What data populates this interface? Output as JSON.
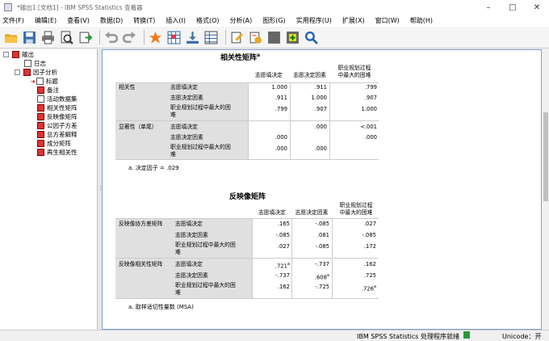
{
  "window": {
    "title": "*输出1 [文档1] - IBM SPSS Statistics 查看器"
  },
  "menu": [
    "文件(F)",
    "编辑(E)",
    "查看(V)",
    "数据(D)",
    "转换(T)",
    "插入(I)",
    "格式(O)",
    "分析(A)",
    "图形(G)",
    "实用程序(U)",
    "扩展(X)",
    "窗口(W)",
    "帮助(H)"
  ],
  "nav": {
    "items": [
      "输出",
      "日志",
      "因子分析",
      "标题",
      "备注",
      "活动数据集",
      "相关性矩阵",
      "反映像矩阵",
      "公因子方差",
      "总方差解释",
      "成分矩阵",
      "再生相关性"
    ]
  },
  "corr": {
    "title": "相关性矩阵",
    "sup": "a",
    "col_headers": [
      "志愿填决定",
      "志愿决定因素",
      "职业规划过程",
      "中最大的困难"
    ],
    "group1": "相关性",
    "group2": "显著性（单尾）",
    "row_labels": [
      "志愿填决定",
      "志愿决定因素",
      "职业规划过程中最大的困",
      "难"
    ],
    "v": [
      [
        "1.000",
        ".911",
        ".799"
      ],
      [
        ".911",
        "1.000",
        ".907"
      ],
      [
        ".799",
        ".907",
        "1.000"
      ]
    ],
    "s": [
      [
        ".000",
        "<.001"
      ],
      [
        ".000",
        ".000"
      ],
      [
        ".000",
        ".000"
      ]
    ],
    "footnote": "a. 决定因子 = .029"
  },
  "anti": {
    "title": "反映像矩阵",
    "col_headers": [
      "志愿填决定",
      "志愿决定因素",
      "职业规划过程",
      "中最大的困难"
    ],
    "group1": "反映像协方差矩阵",
    "group2": "反映像相关性矩阵",
    "row_labels": [
      "志愿填决定",
      "志愿决定因素",
      "职业规划过程中最大的困",
      "难"
    ],
    "cov": [
      [
        ".165",
        "-.085",
        ".027"
      ],
      [
        "-.085",
        ".081",
        "-.085"
      ],
      [
        ".027",
        "-.085",
        ".172"
      ]
    ],
    "cor": [
      [
        ".721",
        "-.737",
        ".162"
      ],
      [
        "-.737",
        ".608",
        ".725"
      ],
      [
        ".162",
        "-.725",
        ".726"
      ]
    ],
    "cor_sup": "a",
    "footnote": "a. 取样适切性量数 (MSA)"
  },
  "status": {
    "processor": "IBM SPSS Statistics 处理程序就绪",
    "unicode": "Unicode：开"
  }
}
